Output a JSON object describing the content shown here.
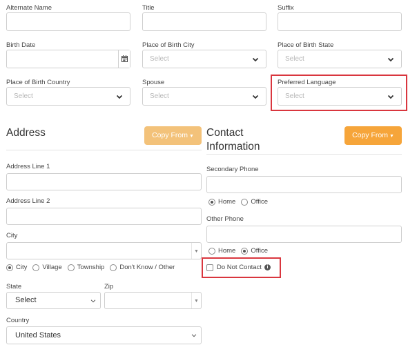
{
  "personal": {
    "alternate_name_label": "Alternate Name",
    "title_label": "Title",
    "suffix_label": "Suffix",
    "birth_date_label": "Birth Date",
    "place_of_birth_city_label": "Place of Birth City",
    "place_of_birth_city_value": "Select",
    "place_of_birth_state_label": "Place of Birth State",
    "place_of_birth_state_value": "Select",
    "place_of_birth_country_label": "Place of Birth Country",
    "place_of_birth_country_value": "Select",
    "spouse_label": "Spouse",
    "spouse_value": "Select",
    "preferred_language_label": "Preferred Language",
    "preferred_language_value": "Select"
  },
  "address": {
    "heading": "Address",
    "copy_from_label": "Copy From",
    "line1_label": "Address Line 1",
    "line2_label": "Address Line 2",
    "city_label": "City",
    "city_type_options": [
      "City",
      "Village",
      "Township",
      "Don't Know / Other"
    ],
    "city_type_selected": "City",
    "state_label": "State",
    "state_value": "Select",
    "zip_label": "Zip",
    "country_label": "Country",
    "country_value": "United States"
  },
  "contact": {
    "heading_line1": "Contact",
    "heading_line2": "Information",
    "copy_from_label": "Copy From",
    "secondary_phone_label": "Secondary Phone",
    "secondary_phone_type_options": [
      "Home",
      "Office"
    ],
    "secondary_phone_type_selected": "Home",
    "other_phone_label": "Other Phone",
    "other_phone_type_options": [
      "Home",
      "Office"
    ],
    "other_phone_type_selected": "Office",
    "do_not_contact_label": "Do Not Contact",
    "do_not_contact_checked": false
  },
  "colors": {
    "highlight_border": "#d9363e",
    "copy_button_dim": "#f3c27a",
    "copy_button_bright": "#f6a53a"
  }
}
